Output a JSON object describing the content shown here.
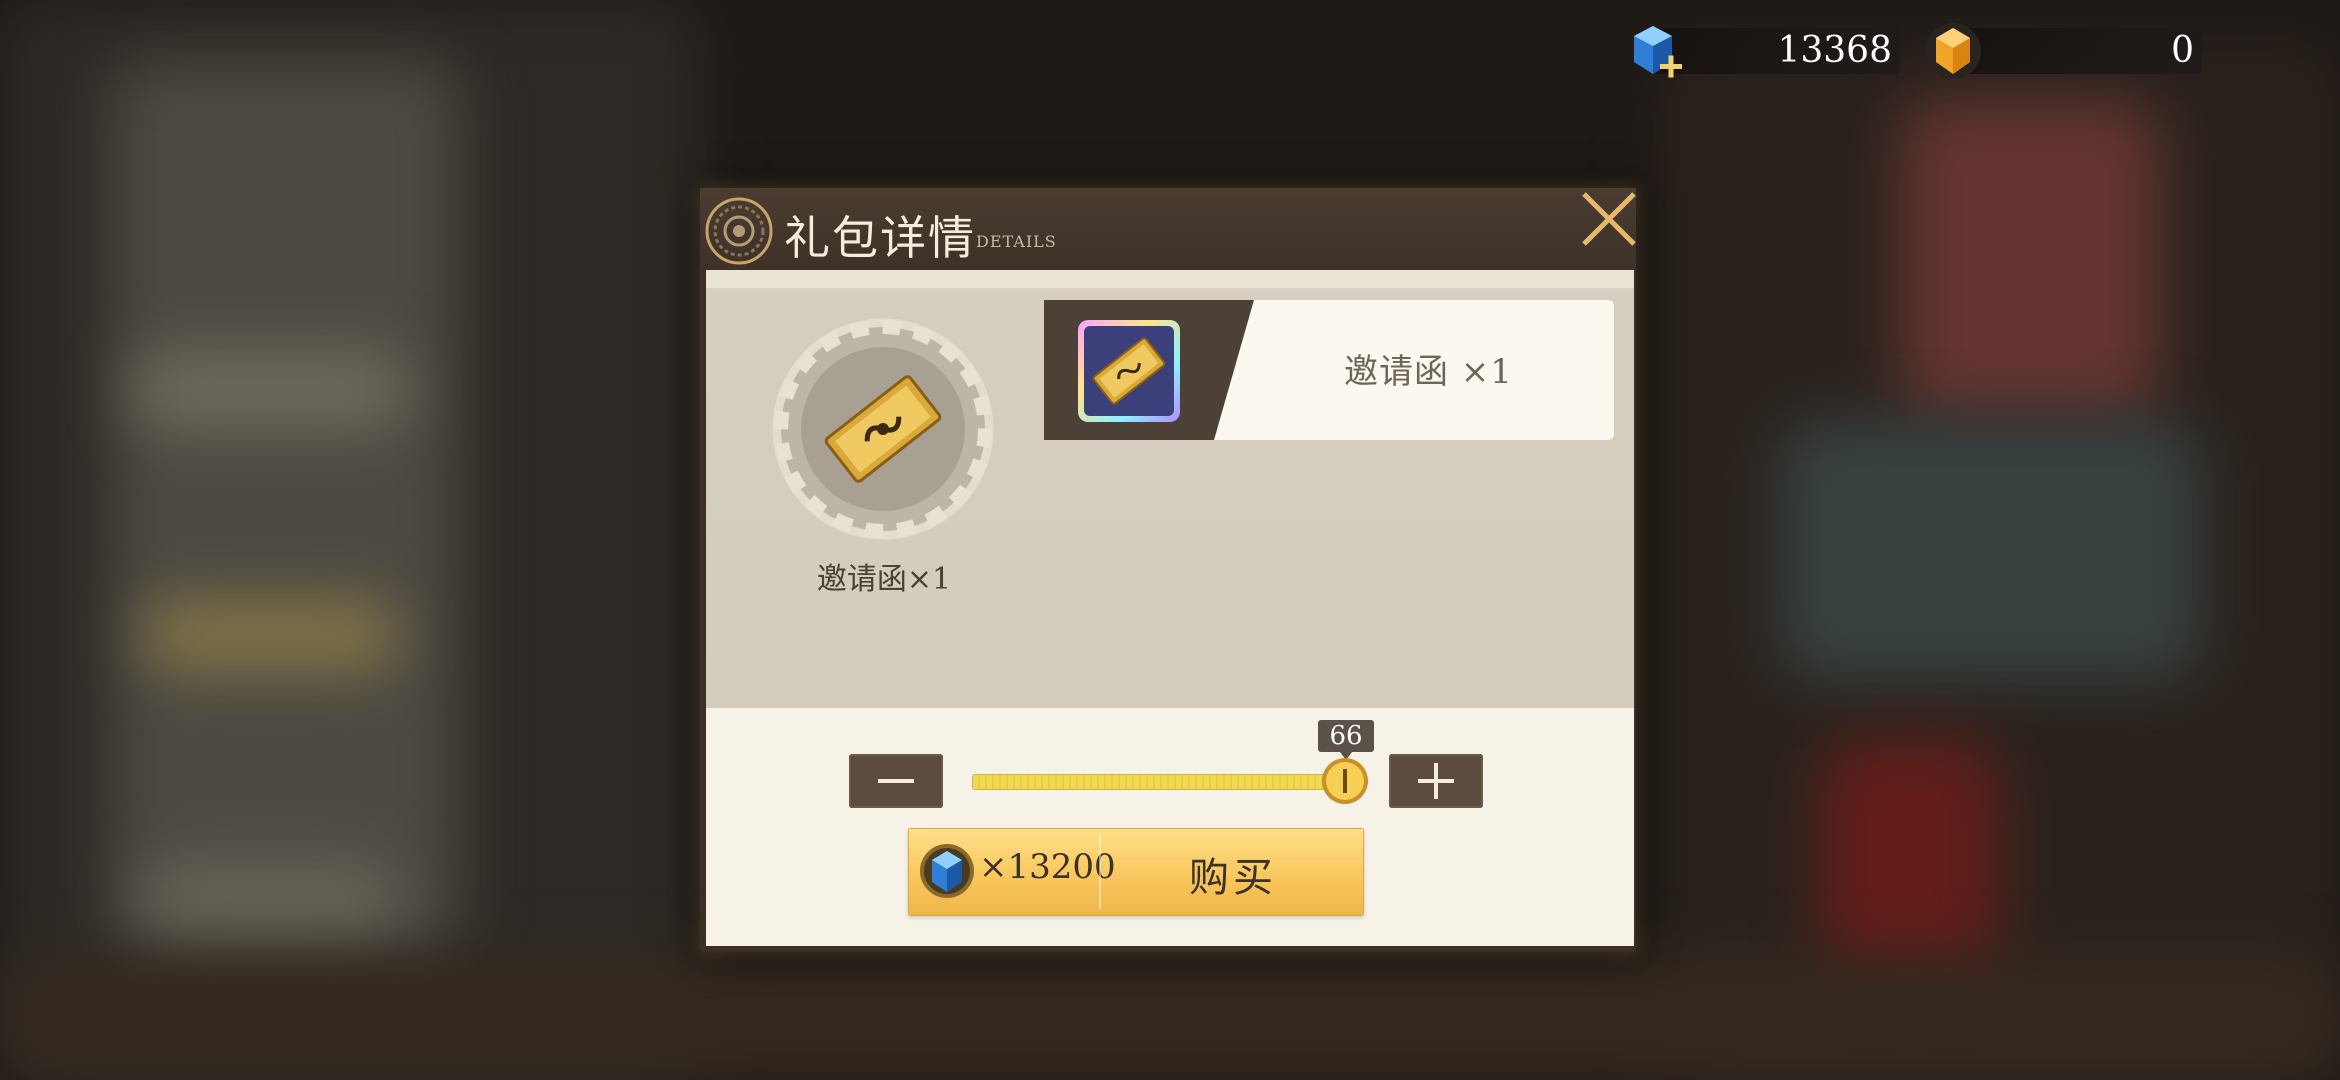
{
  "currency": {
    "gems": {
      "icon": "blue-gem-add-icon",
      "amount": "13368"
    },
    "crystals": {
      "icon": "gold-crystal-icon",
      "amount": "0"
    }
  },
  "dialog": {
    "title": "礼包详情",
    "subtitle": "DETAILS",
    "close_icon": "close-icon",
    "item_caption": "邀请函×1",
    "rewards": [
      {
        "icon": "invitation-ticket-icon",
        "label": "邀请函 ×1"
      }
    ],
    "quantity": {
      "value": "66",
      "fill_fraction": 1.0,
      "decrease_icon": "minus-icon",
      "increase_icon": "plus-icon"
    },
    "buy": {
      "price": "×13200",
      "currency_icon": "blue-gem-icon",
      "label": "购买"
    }
  },
  "colors": {
    "accent_gold": "#f7c55a",
    "dialog_dark": "#3a2e25",
    "panel_light": "#f6f2e7"
  }
}
